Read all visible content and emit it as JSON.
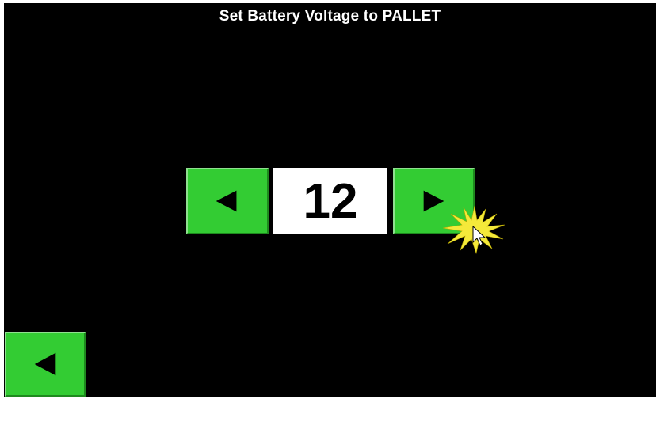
{
  "screen": {
    "title": "Set Battery Voltage to PALLET",
    "value": "12"
  },
  "controls": {
    "decrease_icon": "left-triangle-icon",
    "increase_icon": "right-triangle-icon",
    "back_icon": "left-triangle-icon"
  },
  "colors": {
    "background": "#000000",
    "button": "#33cc33",
    "value_box": "#ffffff",
    "title_text": "#ffffff",
    "click_burst": "#f4e93a"
  }
}
